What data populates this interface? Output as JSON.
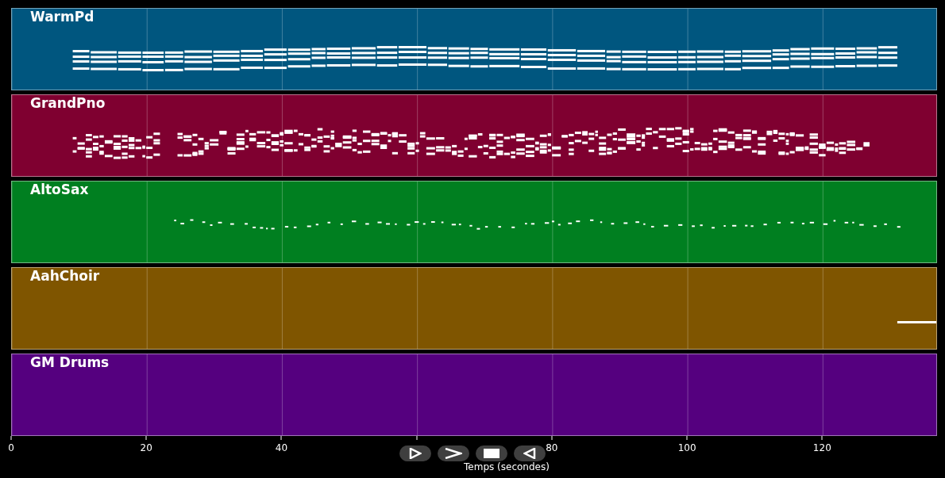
{
  "tracks": [
    {
      "name": "WarmPd",
      "color": "#00567f",
      "kind": "pad"
    },
    {
      "name": "GrandPno",
      "color": "#7f0030",
      "kind": "piano"
    },
    {
      "name": "AltoSax",
      "color": "#007f20",
      "kind": "sax"
    },
    {
      "name": "AahChoir",
      "color": "#7f5500",
      "kind": "choir"
    },
    {
      "name": "GM Drums",
      "color": "#55007f",
      "kind": "empty"
    }
  ],
  "x_axis": {
    "ticks": [
      "0",
      "20",
      "40",
      "80",
      "100",
      "120"
    ],
    "label": "Temps (secondes)"
  },
  "controls": [
    {
      "kind": "play"
    },
    {
      "kind": "forward"
    },
    {
      "kind": "stop"
    },
    {
      "kind": "back"
    }
  ]
}
